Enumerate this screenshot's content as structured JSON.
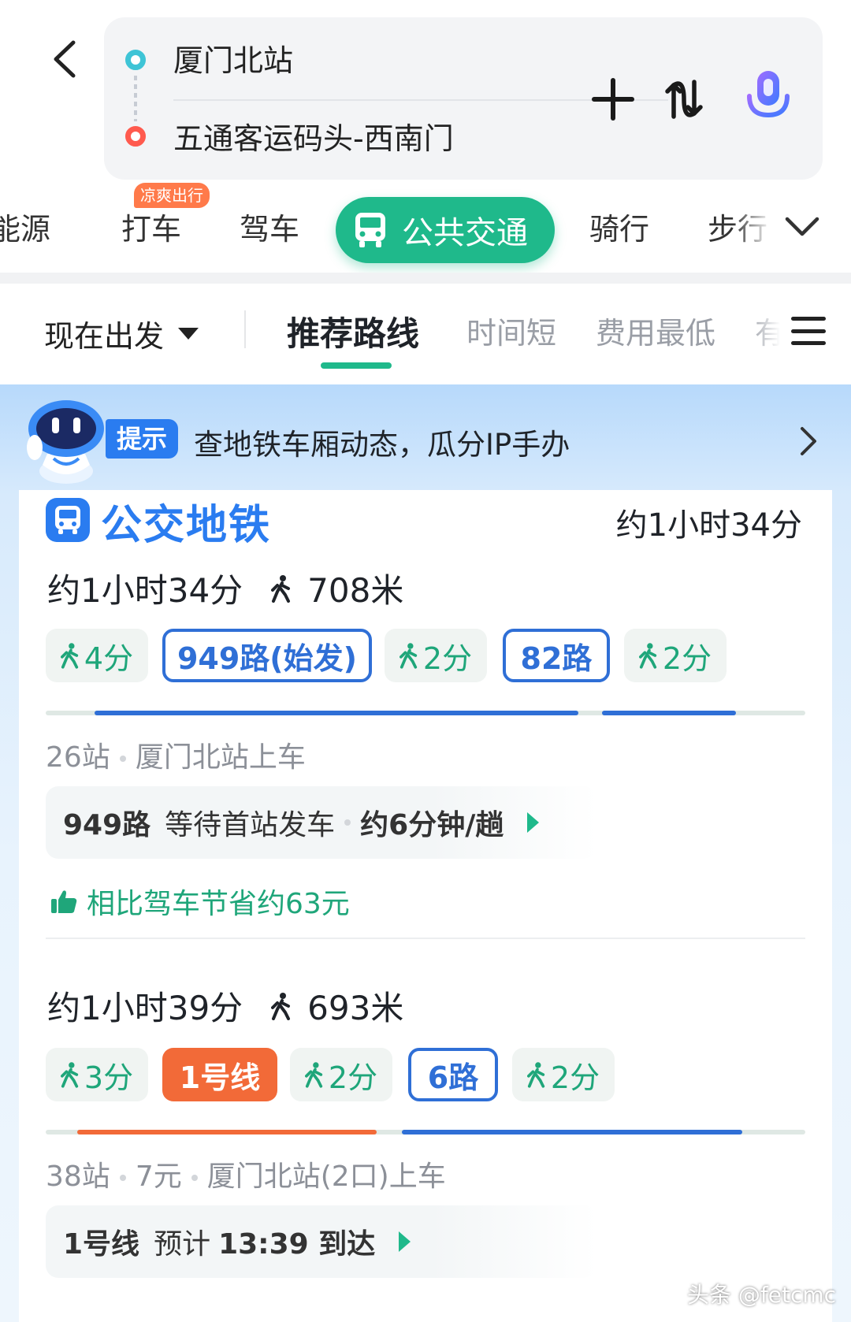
{
  "route": {
    "from": "厦门北站",
    "to": "五通客运码头-西南门"
  },
  "modes": {
    "items": [
      "能源",
      "打车",
      "驾车",
      "骑行",
      "步行"
    ],
    "badge": "凉爽出行",
    "active": "公共交通"
  },
  "sort": {
    "depart": "现在出发",
    "tabs": [
      "推荐路线",
      "时间短",
      "费用最低",
      "有"
    ]
  },
  "tip": {
    "tag": "提示",
    "text": "查地铁车厢动态，瓜分IP手办"
  },
  "card": {
    "title": "公交地铁",
    "time": "约1小时34分"
  },
  "options": [
    {
      "duration": "约1小时34分",
      "walk": "708米",
      "segments": [
        "4分",
        "949路(始发)",
        "2分",
        "82路",
        "2分"
      ],
      "meta": [
        "26站",
        "厦门北站上车"
      ],
      "info": {
        "line": "949路",
        "status": "等待首站发车",
        "freq": "约6分钟/趟"
      },
      "save": "相比驾车节省约63元"
    },
    {
      "duration": "约1小时39分",
      "walk": "693米",
      "segments": [
        "3分",
        "1号线",
        "2分",
        "6路",
        "2分"
      ],
      "meta": [
        "38站",
        "7元",
        "厦门北站(2口)上车"
      ],
      "info": {
        "line": "1号线",
        "status": "预计",
        "arrive": "13:39 到达"
      }
    }
  ],
  "watermark": "头条 @fetcmc",
  "colors": {
    "accent_green": "#1fb98b",
    "bus_blue": "#2f6fd6",
    "metro_orange": "#f26a38",
    "start_dot": "#3ec4d6",
    "end_dot": "#ff5a4e"
  }
}
